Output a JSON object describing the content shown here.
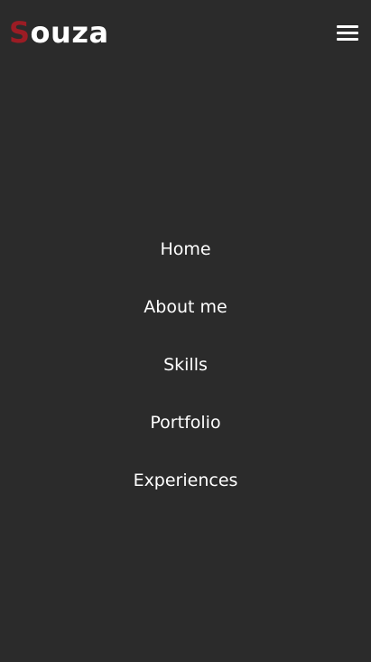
{
  "brand": {
    "first_letter": "S",
    "rest": "ouza",
    "accent_color": "#9b1c24"
  },
  "header": {
    "menu_icon": "hamburger-menu-icon"
  },
  "nav": {
    "items": [
      {
        "label": "Home"
      },
      {
        "label": "About me"
      },
      {
        "label": "Skills"
      },
      {
        "label": "Portfolio"
      },
      {
        "label": "Experiences"
      }
    ]
  },
  "colors": {
    "background": "#2b2b2b",
    "text": "#ffffff"
  }
}
